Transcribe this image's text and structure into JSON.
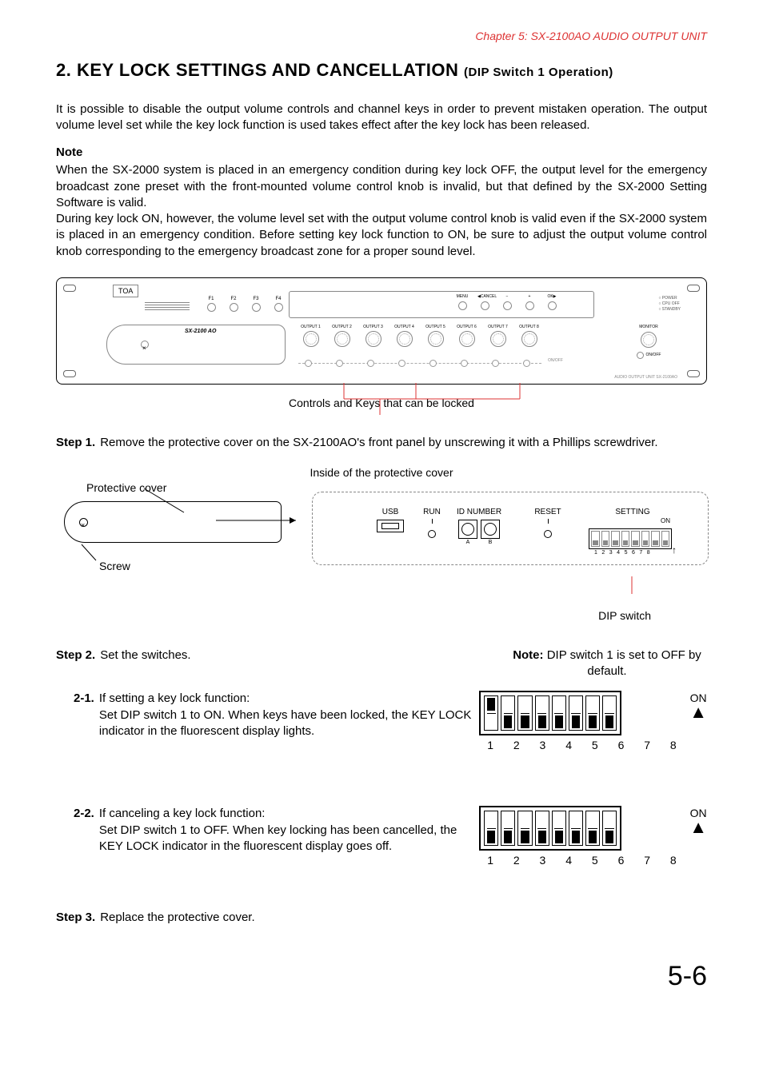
{
  "chapter": "Chapter 5: SX-2100AO AUDIO OUTPUT UNIT",
  "heading_num": "2.",
  "heading_main": "KEY LOCK SETTINGS AND CANCELLATION",
  "heading_sub": "(DIP Switch 1 Operation)",
  "intro_p1": "It is possible to disable the output volume controls and channel keys in order to prevent mistaken operation. The output volume level set while the key lock function is used takes effect after the key lock has been released.",
  "note_title": "Note",
  "note_p1": "When the SX-2000 system is placed in an emergency condition during key lock OFF, the output level for the emergency broadcast zone preset with the front-mounted volume control knob is invalid, but that defined by the SX-2000 Setting Software is valid.",
  "note_p2": "During key lock ON, however, the volume level set with the output volume control knob is valid even if the SX-2000 system is placed in an emergency condition. Before setting key lock function to ON, be sure to adjust the output volume control knob corresponding to the emergency broadcast zone for a proper sound level.",
  "panel": {
    "logo": "TOA",
    "model": "SX-2100 AO",
    "fkeys": [
      "F1",
      "F2",
      "F3",
      "F4"
    ],
    "navkeys": [
      "MENU",
      "◀CANCEL",
      "−",
      "+",
      "OK▶"
    ],
    "leds": [
      "POWER",
      "CPU OFF",
      "STANDBY"
    ],
    "outputs": [
      "OUTPUT 1",
      "OUTPUT 2",
      "OUTPUT 3",
      "OUTPUT 4",
      "OUTPUT 5",
      "OUTPUT 6",
      "OUTPUT 7",
      "OUTPUT 8"
    ],
    "onoff": "ON/OFF",
    "monitor": "MONITOR",
    "bottom": "AUDIO OUTPUT UNIT SX-2100AO"
  },
  "fig1_caption": "Controls and Keys that can be locked",
  "step1_label": "Step 1.",
  "step1_text": "Remove the protective cover on the SX-2100AO's front panel by unscrewing it with a Phillips screwdriver.",
  "fig2": {
    "caption": "Inside of the protective cover",
    "protective_cover": "Protective cover",
    "screw": "Screw",
    "usb": "USB",
    "run": "RUN",
    "id": "ID NUMBER",
    "rot_a": "A",
    "rot_b": "B",
    "reset": "RESET",
    "setting": "SETTING",
    "on": "ON",
    "dip_nums": "12345678",
    "dip_switch_label": "DIP switch"
  },
  "step2_label": "Step 2.",
  "step2_text": "Set the switches.",
  "step2_note_bold": "Note:",
  "step2_note": "DIP switch 1 is set to OFF by default.",
  "sub21_label": "2-1.",
  "sub21_title": "If setting a key lock function:",
  "sub21_text": "Set DIP switch 1 to ON. When keys have been locked, the KEY LOCK indicator in the fluorescent display lights.",
  "sub22_label": "2-2.",
  "sub22_title": "If canceling a key lock function:",
  "sub22_text": "Set DIP switch 1 to OFF. When key locking has been cancelled, the KEY LOCK indicator in the fluorescent display goes off.",
  "dip_on": "ON",
  "dip_numbers": "1  2  3  4  5  6  7  8",
  "step3_label": "Step 3.",
  "step3_text": "Replace the protective cover.",
  "page_number": "5-6"
}
